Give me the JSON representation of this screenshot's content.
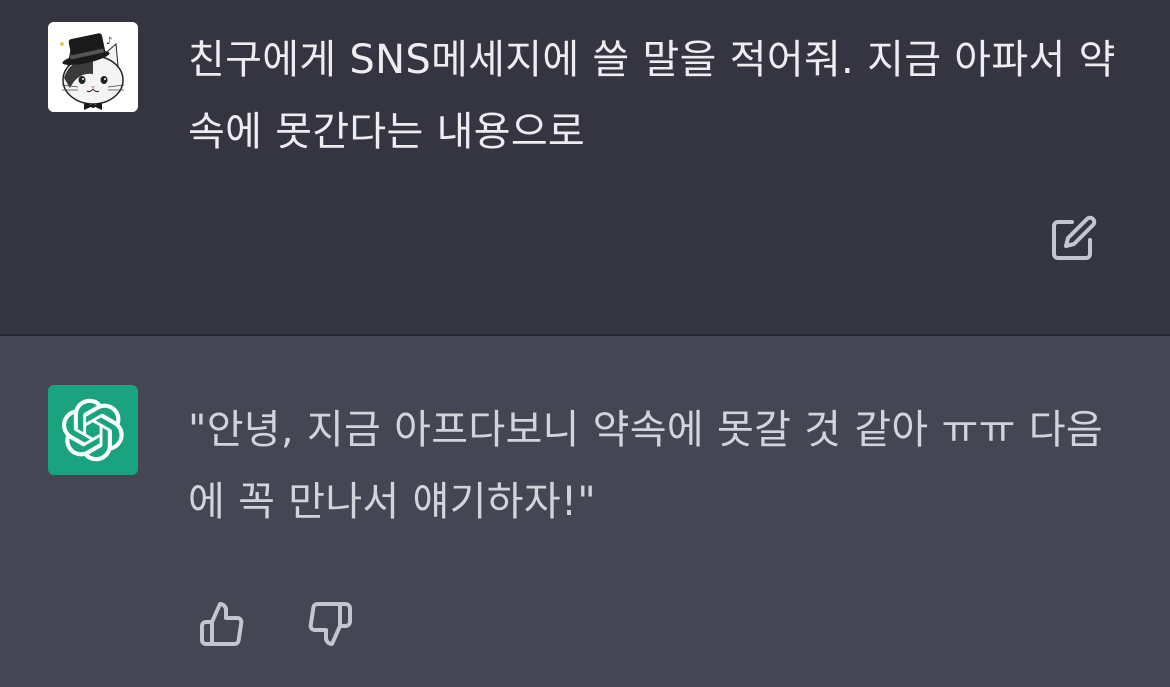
{
  "conversation": {
    "user_message": {
      "avatar_icon": "cat-with-top-hat-avatar",
      "text": "친구에게 SNS메세지에 쓸 말을 적어줘. 지금 아파서 약속에 못간다는 내용으로"
    },
    "assistant_message": {
      "avatar_icon": "openai-logo",
      "avatar_color": "#19a37f",
      "text": "\"안녕, 지금 아프다보니 약속에 못갈 것 같아 ㅠㅠ 다음에 꼭 만나서 얘기하자!\""
    }
  },
  "actions": {
    "edit_icon": "edit-icon",
    "thumbs_up_icon": "thumbs-up-icon",
    "thumbs_down_icon": "thumbs-down-icon"
  },
  "colors": {
    "user_bg": "#343541",
    "assistant_bg": "#444654",
    "text": "#ececf1",
    "icon": "#acacbe"
  }
}
